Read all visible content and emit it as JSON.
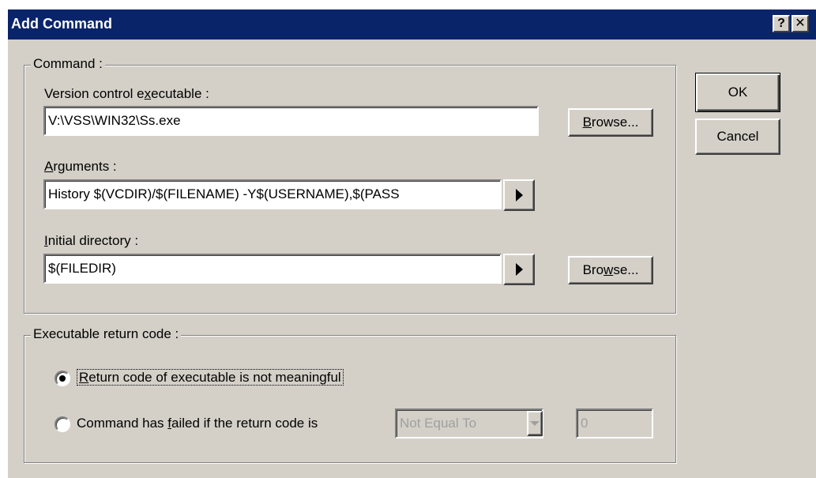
{
  "window": {
    "title": "Add Command",
    "help_label": "?",
    "close_label": "✕"
  },
  "command_group": {
    "legend": "Command :",
    "executable": {
      "label_pre": "Version control e",
      "label_accel": "x",
      "label_post": "ecutable :",
      "value": "V:\\VSS\\WIN32\\Ss.exe",
      "browse_pre": "",
      "browse_accel": "B",
      "browse_post": "rowse..."
    },
    "arguments": {
      "label_pre": "",
      "label_accel": "A",
      "label_post": "rguments :",
      "value": "History $(VCDIR)/$(FILENAME) -Y$(USERNAME),$(PASS"
    },
    "initial_dir": {
      "label_pre": "",
      "label_accel": "I",
      "label_post": "nitial directory :",
      "value": "$(FILEDIR)",
      "browse_pre": "Bro",
      "browse_accel": "w",
      "browse_post": "se..."
    }
  },
  "return_group": {
    "legend": "Executable return code :",
    "option1_pre": "",
    "option1_accel": "R",
    "option1_post": "eturn code of executable is not meaningful",
    "option1_selected": true,
    "option2_pre": "Command has ",
    "option2_accel": "f",
    "option2_post": "ailed if the return code is",
    "option2_selected": false,
    "comparison_value": "Not Equal To",
    "return_code_value": "0"
  },
  "buttons": {
    "ok": "OK",
    "cancel": "Cancel"
  }
}
